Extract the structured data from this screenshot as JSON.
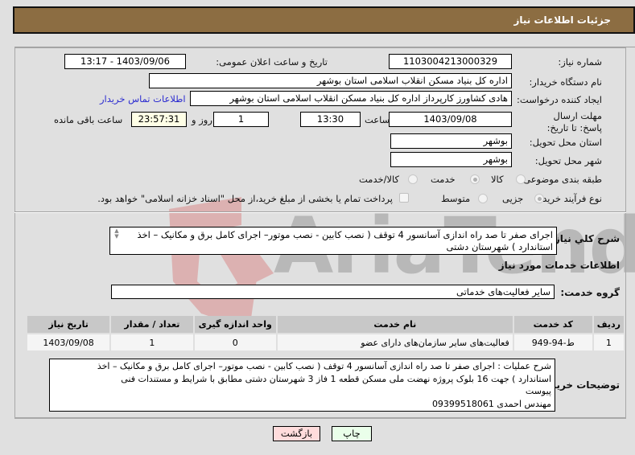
{
  "header": {
    "title": "جزئیات اطلاعات نیاز"
  },
  "fields": {
    "need_number": {
      "label": "شماره نیاز:",
      "value": "1103004213000329"
    },
    "announce_datetime": {
      "label": "تاریخ و ساعت اعلان عمومی:",
      "value": "1403/09/06 - 13:17"
    },
    "buyer_org": {
      "label": "نام دستگاه خریدار:",
      "value": "اداره کل بنیاد مسکن انقلاب اسلامی استان بوشهر"
    },
    "requester": {
      "label": "ایجاد کننده درخواست:",
      "value": "هادی کشاورز کارپرداز اداره کل بنیاد مسکن انقلاب اسلامی استان بوشهر"
    },
    "buyer_contact_link": "اطلاعات تماس خریدار",
    "deadline": {
      "label": "مهلت ارسال پاسخ: تا تاریخ:",
      "date": "1403/09/08",
      "time_label": "ساعت",
      "time": "13:30",
      "days": "1",
      "days_label": "روز و",
      "remaining": "23:57:31",
      "remaining_label": "ساعت باقی مانده"
    },
    "delivery_province": {
      "label": "استان محل تحویل:",
      "value": "بوشهر"
    },
    "delivery_city": {
      "label": "شهر محل تحویل:",
      "value": "بوشهر"
    },
    "category": {
      "label": "طبقه بندی موضوعی:",
      "options": [
        "کالا",
        "خدمت",
        "کالا/خدمت"
      ],
      "selected": "خدمت"
    },
    "purchase_type": {
      "label": "نوع فرآیند خرید :",
      "options": [
        "جزیی",
        "متوسط"
      ],
      "selected": "جزیی",
      "treasury_checkbox_label": "پرداخت تمام یا بخشی از مبلغ خرید،از محل \"اسناد خزانه اسلامی\" خواهد بود.",
      "treasury_checked": false
    }
  },
  "general_description": {
    "label": "شرح کلي نياز:",
    "value": "اجرای صفر تا صد راه اندازی آسانسور 4 توقف ( نصب کابین - نصب موتور– اجرای کامل برق و مکانیک – اخذ استاندارد )  شهرستان دشتی"
  },
  "services_section": {
    "title": "اطلاعات خدمات مورد نیاز",
    "group_label": "گروه خدمت:",
    "group_value": "سایر فعالیت‌های خدماتی",
    "table": {
      "headers": [
        "ردیف",
        "کد خدمت",
        "نام خدمت",
        "واحد اندازه گیری",
        "تعداد / مقدار",
        "تاریخ نیاز"
      ],
      "rows": [
        [
          "1",
          "ط-94-949",
          "فعالیت‌های سایر سازمان‌های دارای عضو",
          "0",
          "1",
          "1403/09/08"
        ]
      ]
    }
  },
  "buyer_notes": {
    "label": "توضیحات خریدار:",
    "lines": [
      "شرح عملیات : اجرای صفر تا صد راه اندازی آسانسور 4 توقف ( نصب کابین - نصب موتور– اجرای کامل برق و مکانیک – اخذ",
      "استاندارد ) جهت 16 بلوک پروژه نهضت ملی مسکن قطعه 1  فاز  3  شهرستان دشتی مطابق با شرایط و  مستندات فنی",
      "پیوست",
      "مهندس احمدی 09399518061"
    ]
  },
  "buttons": {
    "print": "چاپ",
    "back": "بازگشت"
  },
  "watermark": {
    "text": "AriaTender.neT"
  },
  "colors": {
    "header_bg": "#8c6d42",
    "print_bg": "#eaffea",
    "back_bg": "#ffdcdc",
    "link": "#2b2bd0"
  }
}
